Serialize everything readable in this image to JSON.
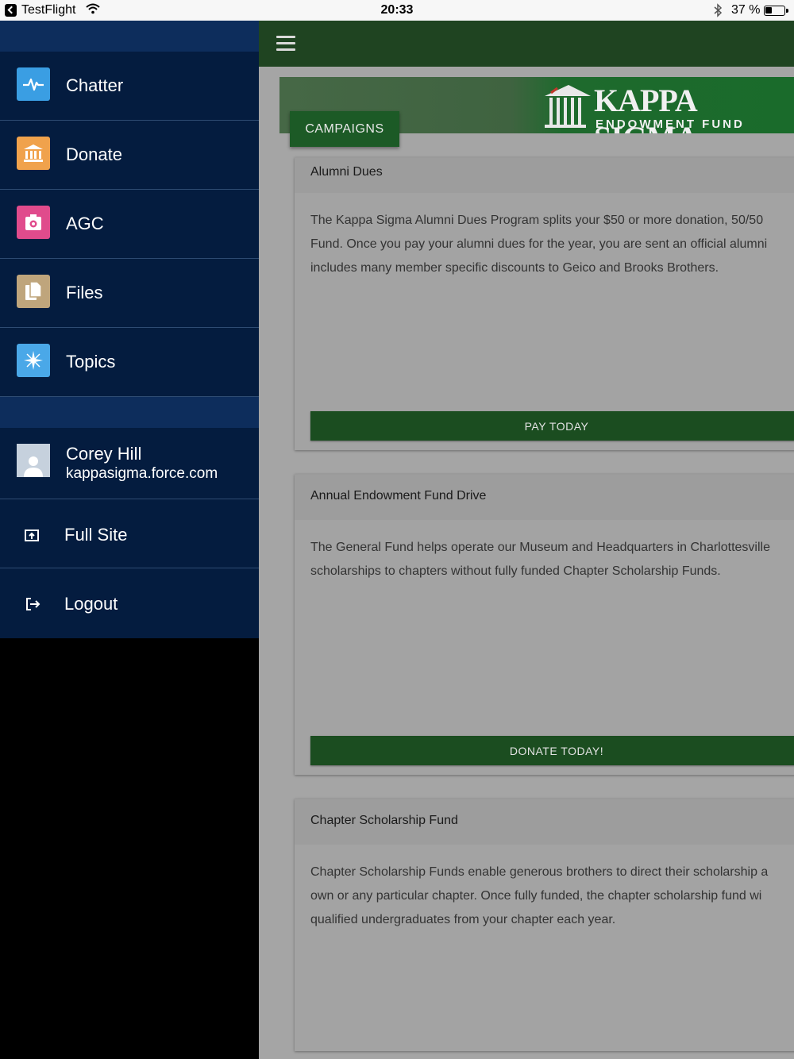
{
  "status_bar": {
    "app": "TestFlight",
    "time": "20:33",
    "battery_text": "37 %",
    "battery_level": 0.37
  },
  "sidebar": {
    "nav_items": [
      {
        "label": "Chatter",
        "icon": "chatter-pulse-icon",
        "color": "#3a9ee3"
      },
      {
        "label": "Donate",
        "icon": "bank-icon",
        "color": "#f0a24c"
      },
      {
        "label": "AGC",
        "icon": "camera-icon",
        "color": "#e04b8c"
      },
      {
        "label": "Files",
        "icon": "files-icon",
        "color": "#bfa57c"
      },
      {
        "label": "Topics",
        "icon": "topics-icon",
        "color": "#4aa8e8"
      }
    ],
    "user": {
      "name": "Corey Hill",
      "domain": "kappasigma.force.com"
    },
    "links": [
      {
        "label": "Full Site",
        "icon": "full-site-icon"
      },
      {
        "label": "Logout",
        "icon": "logout-icon"
      }
    ]
  },
  "banner": {
    "title": "KAPPA SIGMA",
    "subtitle": "ENDOWMENT FUND",
    "tab_label": "CAMPAIGNS"
  },
  "campaigns": [
    {
      "title": "Alumni Dues",
      "lines": [
        "The Kappa Sigma Alumni Dues Program splits your $50 or more donation, 50/50",
        "Fund. Once you pay your alumni dues for the year, you are sent an official alumni",
        "includes many member specific discounts to Geico and Brooks Brothers."
      ],
      "button": "PAY TODAY"
    },
    {
      "title": "Annual Endowment Fund Drive",
      "lines": [
        "The General Fund helps operate our Museum and Headquarters in Charlottesville",
        "scholarships to chapters without fully funded Chapter Scholarship Funds."
      ],
      "button": "DONATE TODAY!"
    },
    {
      "title": "Chapter Scholarship Fund",
      "lines": [
        "Chapter Scholarship Funds enable generous brothers to direct their scholarship a",
        "own or any particular chapter. Once fully funded, the chapter scholarship fund wi",
        "qualified undergraduates from your chapter each year."
      ],
      "button": ""
    }
  ]
}
